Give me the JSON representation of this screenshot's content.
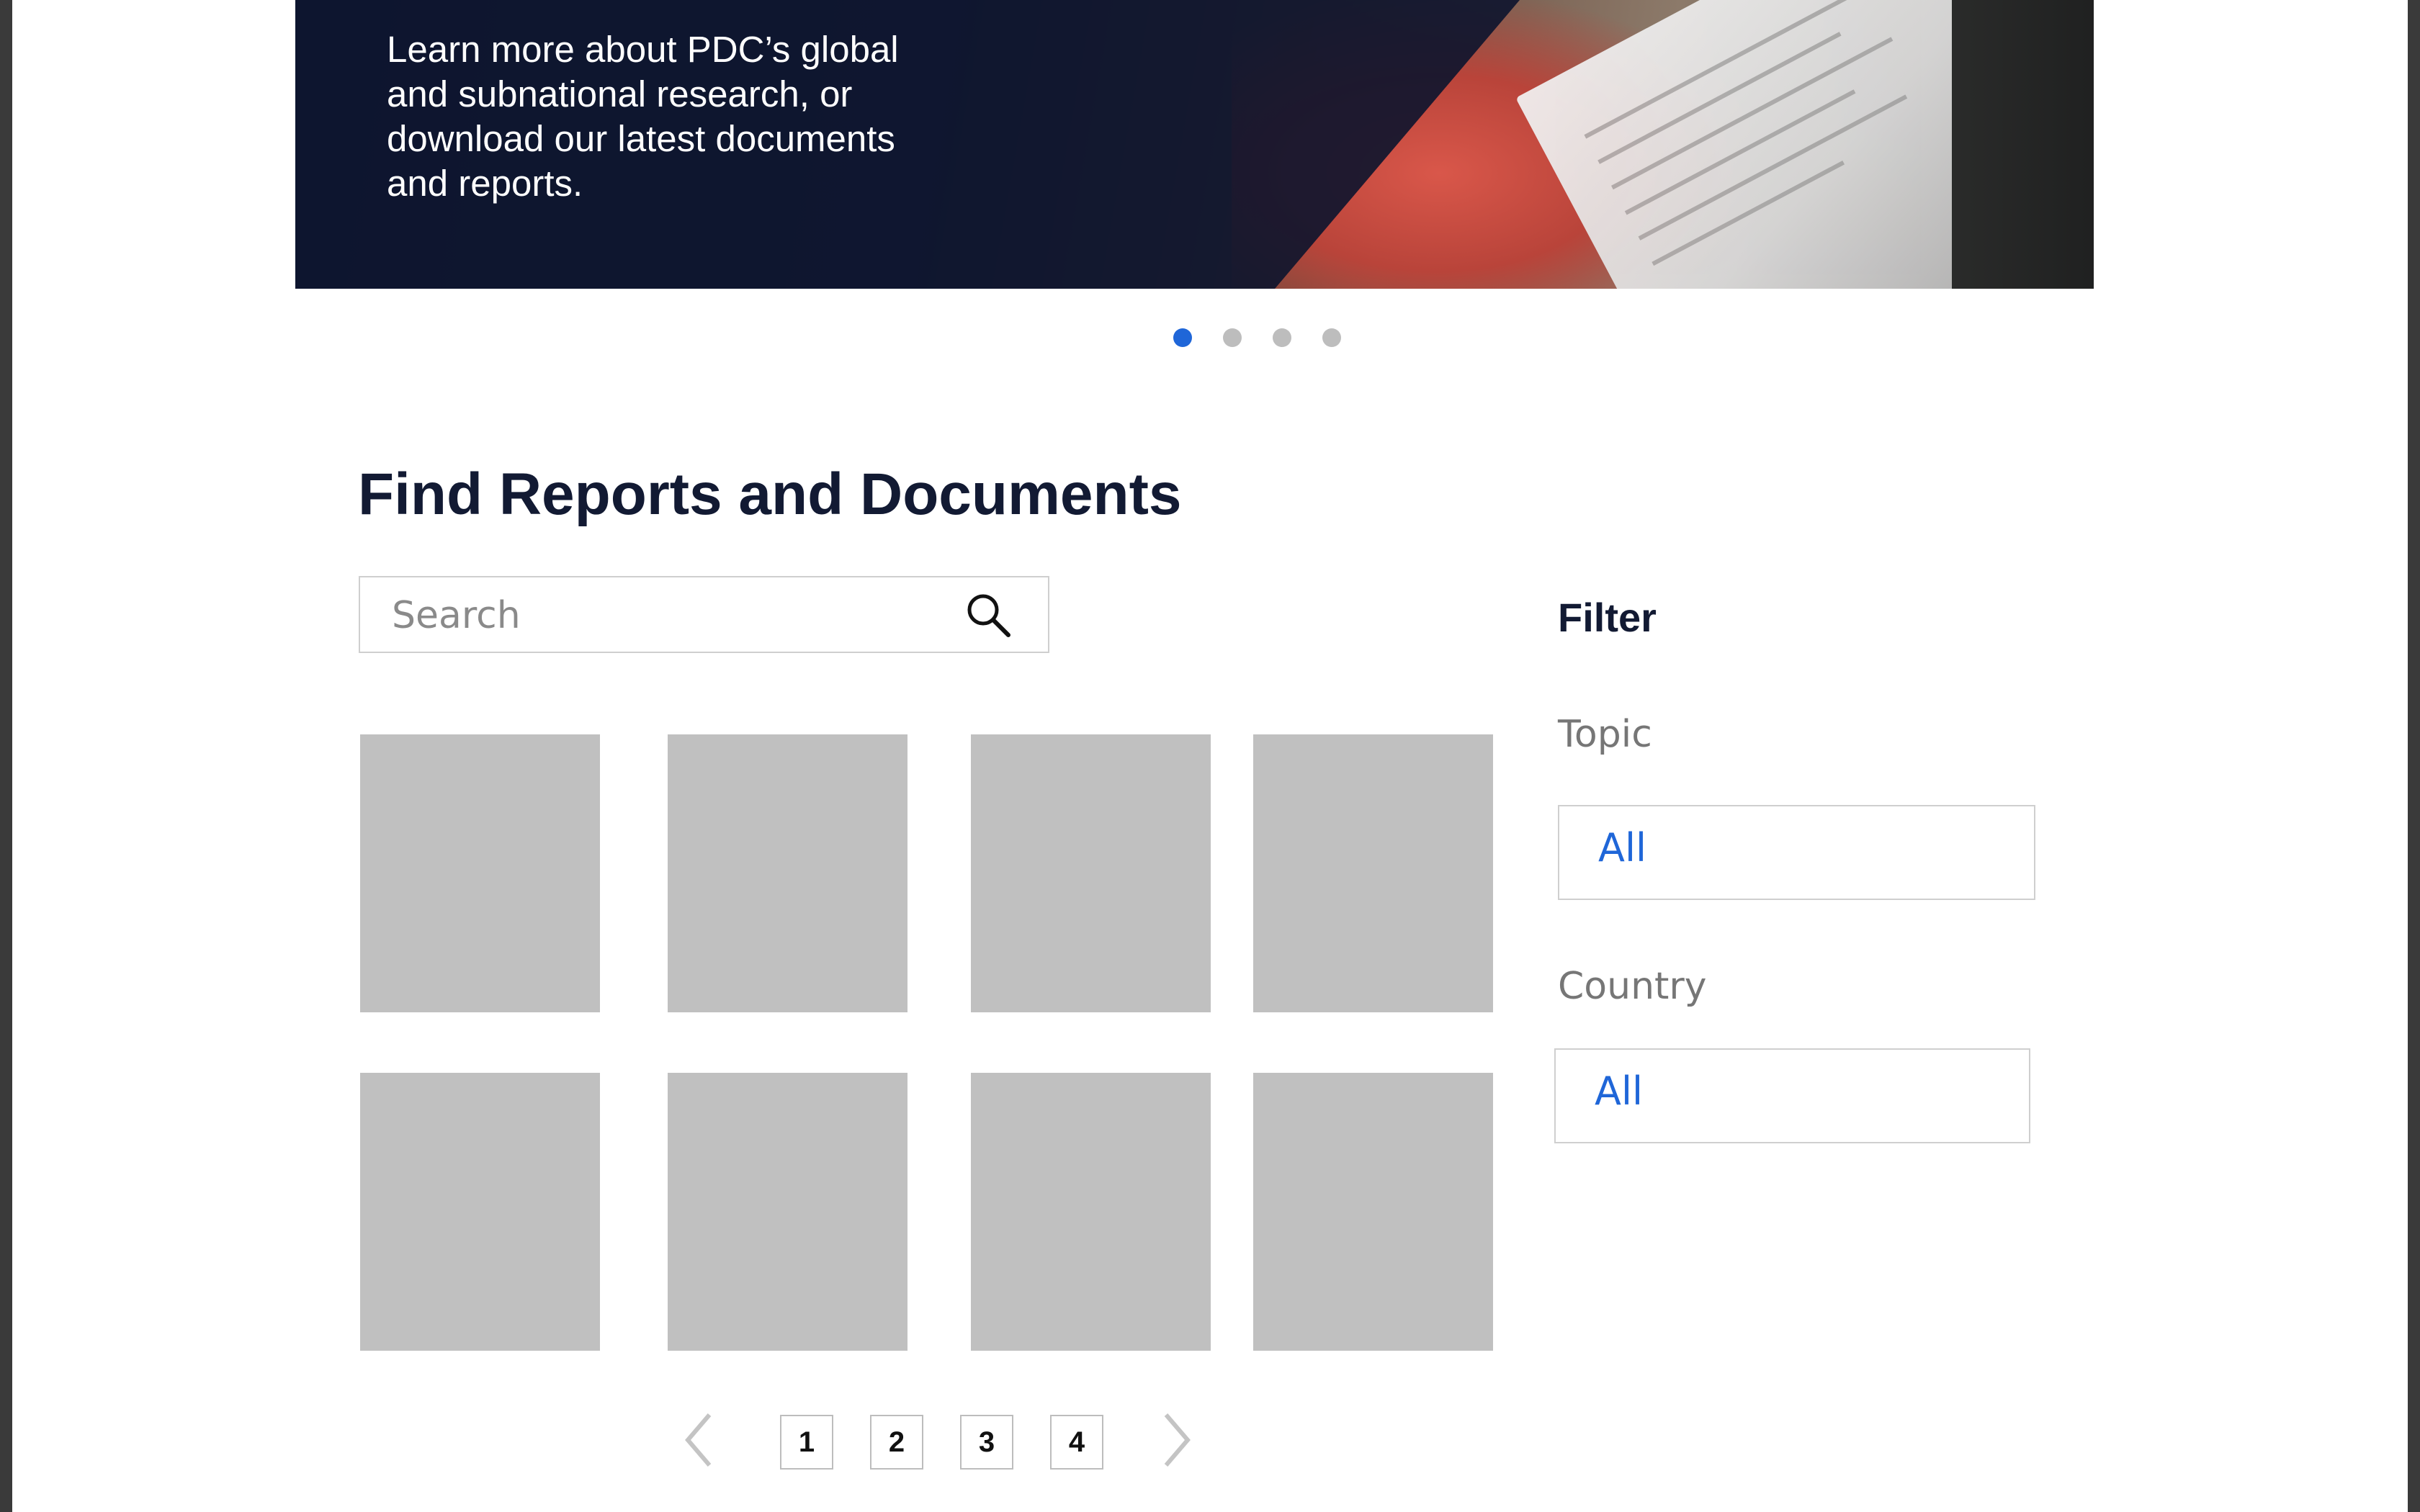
{
  "hero": {
    "text": "Learn more about PDC’s global and subnational research, or download our latest documents and reports."
  },
  "carousel": {
    "slide_count": 4,
    "active_index": 0
  },
  "colors": {
    "accent": "#1f66d8",
    "heading": "#121a33",
    "placeholder_tile": "#c0c0c0",
    "inactive_dot": "#bdbdbd"
  },
  "main": {
    "heading": "Find Reports and Documents",
    "search": {
      "placeholder": "Search",
      "icon": "search-icon"
    }
  },
  "pagination": {
    "pages": [
      "1",
      "2",
      "3",
      "4"
    ],
    "prev_icon": "chevron-left-icon",
    "next_icon": "chevron-right-icon"
  },
  "filter": {
    "title": "Filter",
    "topic": {
      "label": "Topic",
      "value": "All"
    },
    "country": {
      "label": "Country",
      "value": "All"
    }
  }
}
